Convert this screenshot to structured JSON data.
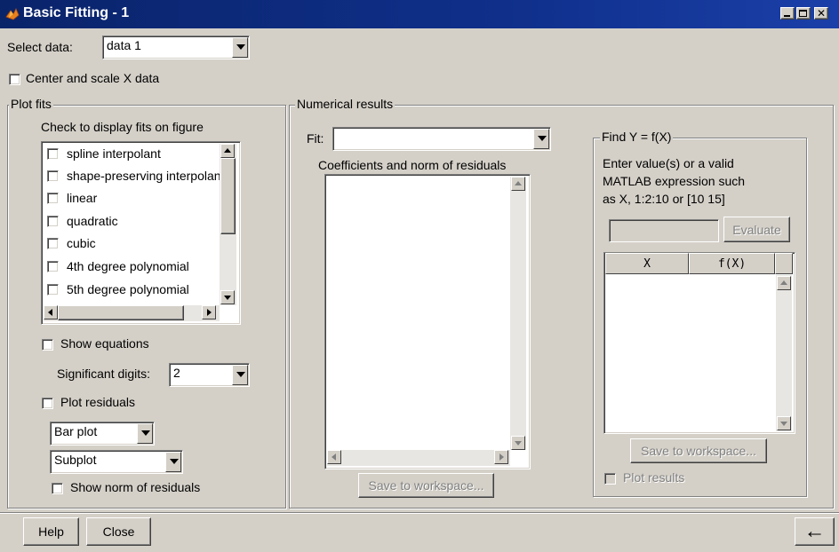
{
  "window": {
    "title": "Basic Fitting - 1",
    "controls": [
      "_",
      "□",
      "X"
    ]
  },
  "select_data": {
    "label": "Select data:",
    "value": "data 1"
  },
  "center_scale": {
    "label": "Center and scale X data",
    "checked": false
  },
  "plot_fits": {
    "title": "Plot fits",
    "instruction": "Check to display fits on figure",
    "fits": [
      {
        "label": "spline interpolant",
        "checked": false
      },
      {
        "label": "shape-preserving interpolant",
        "checked": false
      },
      {
        "label": "linear",
        "checked": false
      },
      {
        "label": "quadratic",
        "checked": false
      },
      {
        "label": "cubic",
        "checked": false
      },
      {
        "label": "4th degree polynomial",
        "checked": false
      },
      {
        "label": "5th degree polynomial",
        "checked": false
      }
    ],
    "show_equations": {
      "label": "Show equations",
      "checked": false
    },
    "significant_digits": {
      "label": "Significant digits:",
      "value": "2"
    },
    "plot_residuals": {
      "label": "Plot residuals",
      "checked": false
    },
    "residual_plot_type": "Bar plot",
    "residual_plot_location": "Subplot",
    "show_norm": {
      "label": "Show norm of residuals",
      "checked": false
    }
  },
  "numerical_results": {
    "title": "Numerical results",
    "fit_label": "Fit:",
    "fit_value": "",
    "coeff_label": "Coefficients and norm of residuals",
    "save_button": "Save to workspace..."
  },
  "find_y": {
    "title": "Find Y = f(X)",
    "instruction_lines": [
      "Enter value(s) or a valid",
      "MATLAB expression such",
      "as X, 1:2:10 or [10 15]"
    ],
    "input_value": "",
    "evaluate_button": "Evaluate",
    "table_headers": [
      "X",
      "f(X)"
    ],
    "save_button": "Save to workspace...",
    "plot_results": {
      "label": "Plot results",
      "checked": false
    }
  },
  "footer": {
    "help_button": "Help",
    "close_button": "Close",
    "arrow_button": "←"
  },
  "colors": {
    "titlebar": "#0a246a",
    "face": "#d4d0c8",
    "disabled_text": "#808080"
  }
}
